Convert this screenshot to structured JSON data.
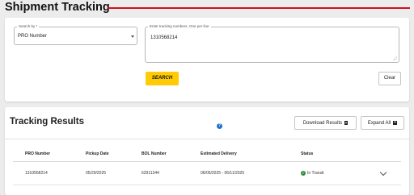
{
  "header": {
    "title": "Shipment Tracking"
  },
  "search": {
    "search_by_label": "Search by *",
    "search_by_value": "PRO Number",
    "numbers_label": "Enter tracking numbers. One per line",
    "numbers_value": "1310568214",
    "search_button": "SEARCH",
    "clear_button": "Clear"
  },
  "results": {
    "title": "Tracking Results",
    "download_button": "Download Results",
    "expand_button": "Expand All",
    "columns": [
      "PRO Number",
      "Pickup Date",
      "BOL Number",
      "Estimated Delivery",
      "Status"
    ],
    "rows": [
      {
        "pro_number": "1310568214",
        "pickup_date": "05/29/2025",
        "bol_number": "62911344",
        "estimated_delivery": "06/05/2025 - 06/11/2025",
        "status": "In Transit"
      }
    ]
  },
  "colors": {
    "accent_red": "#d0101a",
    "search_yellow": "#ffcb05",
    "status_green": "#2e8b3c",
    "help_blue": "#1f74c9"
  },
  "icons": [
    "chevron-down-icon",
    "resize-handle-icon",
    "document-download-icon",
    "plus-box-icon",
    "help-icon",
    "check-circle-icon",
    "chevron-down-icon"
  ]
}
